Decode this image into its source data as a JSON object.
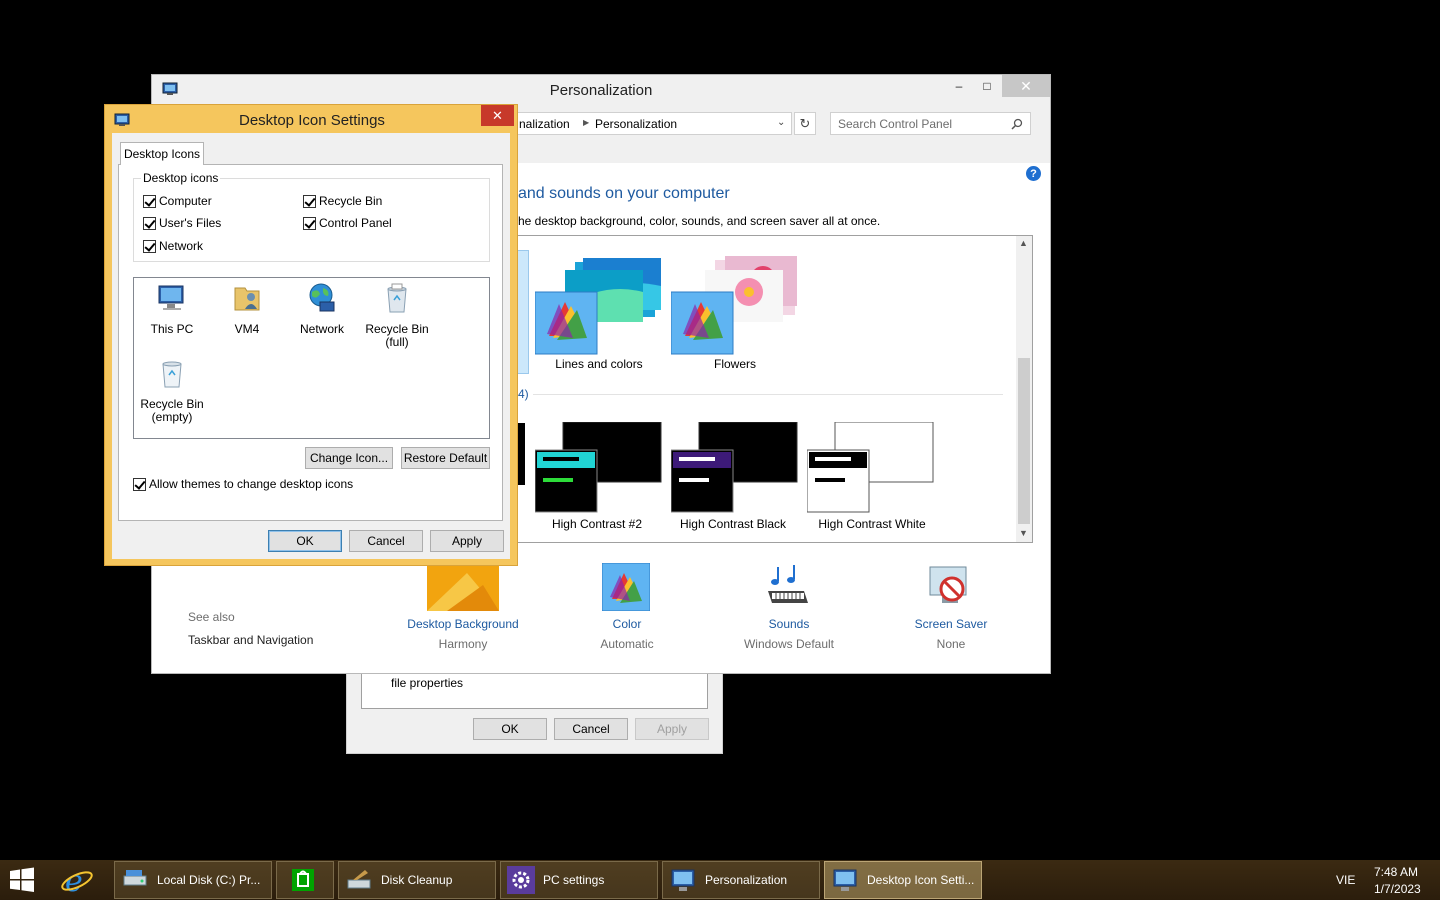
{
  "file_props_window": {
    "text": "file properties",
    "ok_label": "OK",
    "cancel_label": "Cancel",
    "apply_label": "Apply"
  },
  "personalization_window": {
    "title": "Personalization",
    "minimize_glyph": "–",
    "maximize_glyph": "□",
    "close_glyph": "✕",
    "breadcrumb": [
      "nalization",
      "Personalization"
    ],
    "search_placeholder": "Search Control Panel",
    "heading": "and sounds on your computer",
    "subheading": "he desktop background, color, sounds, and screen saver all at once.",
    "section_fragment": "4)",
    "themes_row1": [
      {
        "name": "Lines and colors"
      },
      {
        "name": "Flowers"
      }
    ],
    "themes_row2": [
      {
        "name": "High Contrast #2"
      },
      {
        "name": "High Contrast Black"
      },
      {
        "name": "High Contrast White"
      }
    ],
    "see_also_label": "See also",
    "see_also_links": [
      "Taskbar and Navigation"
    ],
    "bottom_items": [
      {
        "title": "Desktop Background",
        "value": "Harmony",
        "icon": "desktop-background-icon"
      },
      {
        "title": "Color",
        "value": "Automatic",
        "icon": "color-icon"
      },
      {
        "title": "Sounds",
        "value": "Windows Default",
        "icon": "sounds-icon"
      },
      {
        "title": "Screen Saver",
        "value": "None",
        "icon": "screen-saver-icon"
      }
    ]
  },
  "desktop_icon_settings": {
    "title": "Desktop Icon Settings",
    "close_glyph": "✕",
    "tab_label": "Desktop Icons",
    "group_label": "Desktop icons",
    "checkboxes": [
      {
        "label": "Computer",
        "checked": true
      },
      {
        "label": "Recycle Bin",
        "checked": true
      },
      {
        "label": "User's Files",
        "checked": true
      },
      {
        "label": "Control Panel",
        "checked": true
      },
      {
        "label": "Network",
        "checked": true
      }
    ],
    "icons": [
      {
        "label": "This PC",
        "icon": "this-pc-icon"
      },
      {
        "label": "VM4",
        "icon": "user-folder-icon"
      },
      {
        "label": "Network",
        "icon": "network-icon"
      },
      {
        "label": "Recycle Bin\n(full)",
        "icon": "recycle-bin-full-icon"
      },
      {
        "label": "Recycle Bin\n(empty)",
        "icon": "recycle-bin-empty-icon"
      }
    ],
    "change_icon_label": "Change Icon...",
    "restore_default_label": "Restore Default",
    "allow_themes_label": "Allow themes to change desktop icons",
    "allow_themes_checked": true,
    "ok_label": "OK",
    "cancel_label": "Cancel",
    "apply_label": "Apply"
  },
  "taskbar": {
    "items": [
      {
        "label": "Local Disk (C:) Pr...",
        "icon": "drive-icon",
        "active": false
      },
      {
        "label": "",
        "icon": "store-icon",
        "active": false
      },
      {
        "label": "Disk Cleanup",
        "icon": "disk-cleanup-icon",
        "active": false
      },
      {
        "label": "PC settings",
        "icon": "gear-icon",
        "active": false
      },
      {
        "label": "Personalization",
        "icon": "personalization-icon",
        "active": false
      },
      {
        "label": "Desktop Icon Setti...",
        "icon": "desktop-icon-settings-icon",
        "active": true
      }
    ],
    "language": "VIE",
    "time": "7:48 AM",
    "date": "1/7/2023"
  },
  "colors": {
    "dialog_frame": "#f5c65d",
    "close_red": "#c7392a",
    "link_blue": "#1e5aa0",
    "taskbar_bg": "#2b1d0c"
  }
}
